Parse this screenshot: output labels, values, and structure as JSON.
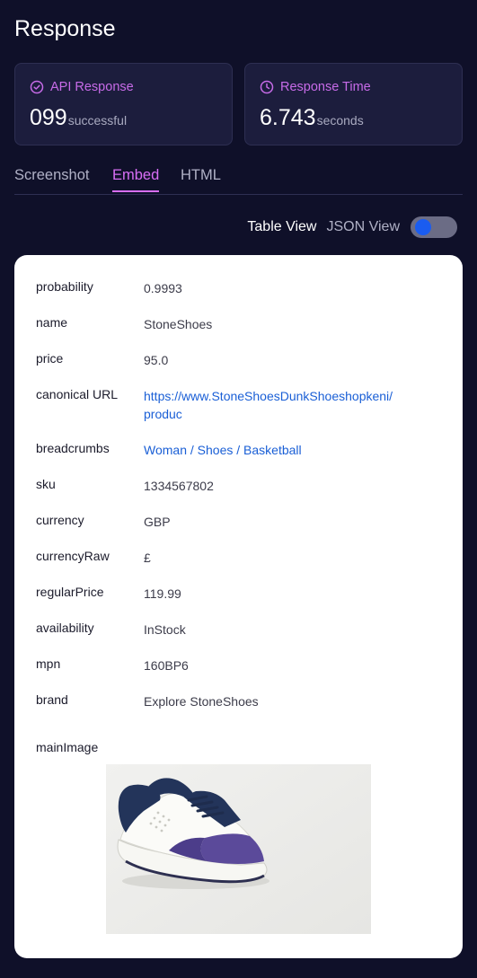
{
  "page_title": "Response",
  "cards": {
    "api": {
      "label": "API Response",
      "value": "099",
      "unit": "successful"
    },
    "time": {
      "label": "Response Time",
      "value": "6.743",
      "unit": "seconds"
    }
  },
  "tabs": {
    "screenshot": "Screenshot",
    "embed": "Embed",
    "html": "HTML",
    "active": "Embed"
  },
  "view_toggle": {
    "table": "Table View",
    "json": "JSON View"
  },
  "fields": {
    "probability": {
      "key": "probability",
      "value": "0.9993"
    },
    "name": {
      "key": "name",
      "value": "StoneShoes"
    },
    "price": {
      "key": "price",
      "value": "95.0"
    },
    "canonical_url": {
      "key": "canonical URL",
      "line1": "https://www.StoneShoesDunkShoeshopkeni/",
      "line2": "produc"
    },
    "breadcrumbs": {
      "key": "breadcrumbs",
      "items": [
        "Woman",
        "Shoes",
        "Basketball"
      ],
      "sep": "/"
    },
    "sku": {
      "key": "sku",
      "value": "1334567802"
    },
    "currency": {
      "key": "currency",
      "value": "GBP"
    },
    "currencyRaw": {
      "key": "currencyRaw",
      "value": "£"
    },
    "regularPrice": {
      "key": "regularPrice",
      "value": "119.99"
    },
    "availability": {
      "key": "availability",
      "value": "InStock"
    },
    "mpn": {
      "key": "mpn",
      "value": "160BP6"
    },
    "brand": {
      "key": "brand",
      "value": "Explore StoneShoes"
    }
  },
  "main_image": {
    "key": "mainImage",
    "icon": "sneaker-image"
  },
  "colors": {
    "background": "#0f1029",
    "card": "#1c1d3d",
    "accent": "#c76be8",
    "link": "#1a5fd6",
    "toggle_knob": "#1a5cf0"
  }
}
